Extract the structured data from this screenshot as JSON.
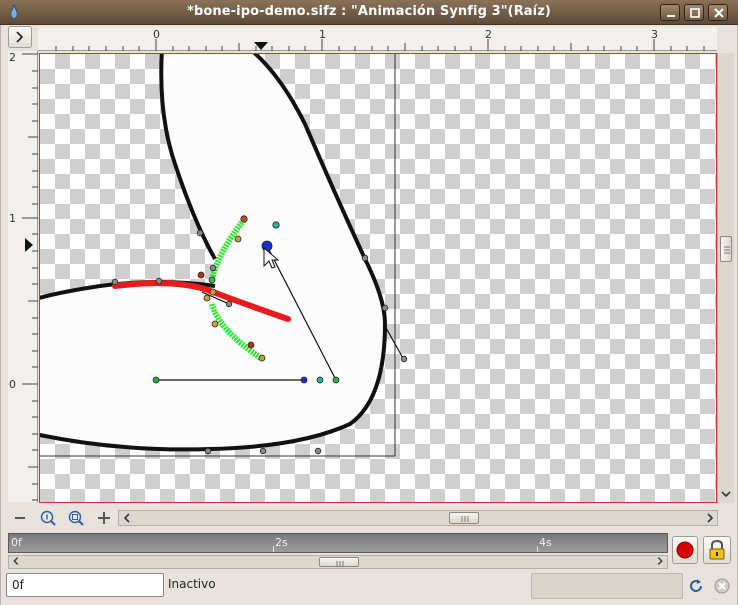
{
  "window": {
    "title": "*bone-ipo-demo.sifz : \"Animación Synfig 3\"(Raíz)"
  },
  "rulers": {
    "horizontal_labels": [
      "0",
      "1",
      "2",
      "3"
    ],
    "vertical_labels": [
      "2",
      "1",
      "0"
    ]
  },
  "timebar": {
    "labels": [
      "0f",
      "2s",
      "4s"
    ]
  },
  "statusbar": {
    "time_value": "0f",
    "status_text": "Inactivo"
  },
  "colors": {
    "title_bar": "#6e5a44",
    "canvas_border": "#d43030",
    "record_button": "#d80000",
    "bone_green": "#2ee82e",
    "bone_red": "#e81c1c"
  },
  "icons": {
    "toggle": "chevron-right-icon",
    "minimize": "minimize-icon",
    "maximize": "maximize-icon",
    "close": "close-icon",
    "zoom_out": "zoom-out-icon",
    "zoom_in": "zoom-in-icon",
    "zoom_fit": "zoom-fit-icon",
    "add": "plus-icon",
    "record": "record-icon",
    "lock": "lock-icon",
    "refresh": "refresh-icon",
    "stop": "stop-icon"
  }
}
